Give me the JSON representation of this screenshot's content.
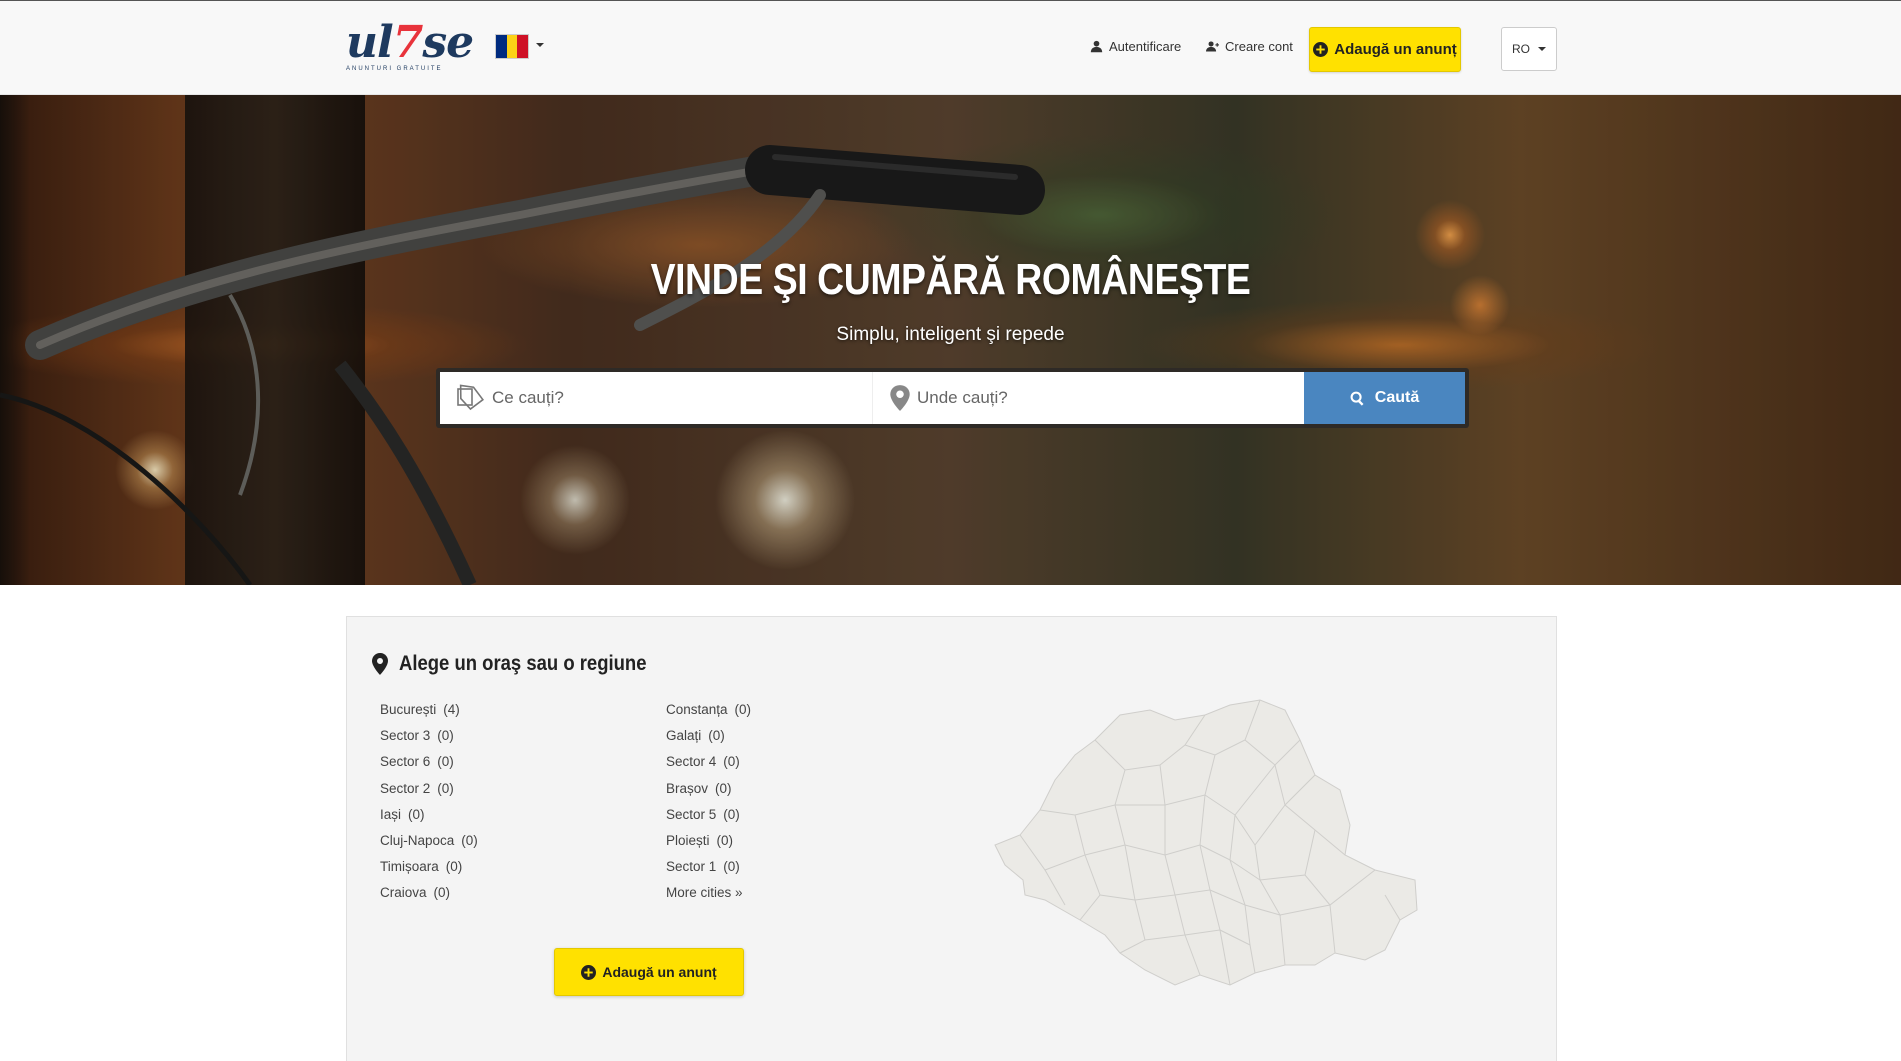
{
  "brand": {
    "logo_text_a": "ul",
    "logo_text_b": "7",
    "logo_text_c": "se",
    "tagline": "ANUNTURI GRATUITE",
    "accent_color": "#ffe100",
    "primary_color": "#4a86c0",
    "logo_color": "#1e3a5f"
  },
  "header": {
    "country_flag_icon": "romania-flag-icon",
    "login_label": "Autentificare",
    "register_label": "Creare cont",
    "add_listing_label": "Adaugă un anunț",
    "language": "RO"
  },
  "hero": {
    "title": "VINDE ŞI CUMPĂRĂ ROMÂNEŞTE",
    "subtitle": "Simplu, inteligent şi repede",
    "search": {
      "what_placeholder": "Ce cauți?",
      "where_placeholder": "Unde cauți?",
      "button_label": "Caută"
    }
  },
  "regions": {
    "title": "Alege un oraş sau o regiune",
    "left_column": [
      {
        "name": "București",
        "count": "(4)"
      },
      {
        "name": "Sector 3",
        "count": "(0)"
      },
      {
        "name": "Sector 6",
        "count": "(0)"
      },
      {
        "name": "Sector 2",
        "count": "(0)"
      },
      {
        "name": "Iași",
        "count": "(0)"
      },
      {
        "name": "Cluj-Napoca",
        "count": "(0)"
      },
      {
        "name": "Timișoara",
        "count": "(0)"
      },
      {
        "name": "Craiova",
        "count": "(0)"
      }
    ],
    "right_column": [
      {
        "name": "Constanța",
        "count": "(0)"
      },
      {
        "name": "Galați",
        "count": "(0)"
      },
      {
        "name": "Sector 4",
        "count": "(0)"
      },
      {
        "name": "Brașov",
        "count": "(0)"
      },
      {
        "name": "Sector 5",
        "count": "(0)"
      },
      {
        "name": "Ploiești",
        "count": "(0)"
      },
      {
        "name": "Sector 1",
        "count": "(0)"
      },
      {
        "name": "More cities »",
        "count": ""
      }
    ],
    "add_listing_label": "Adaugă un anunț"
  }
}
